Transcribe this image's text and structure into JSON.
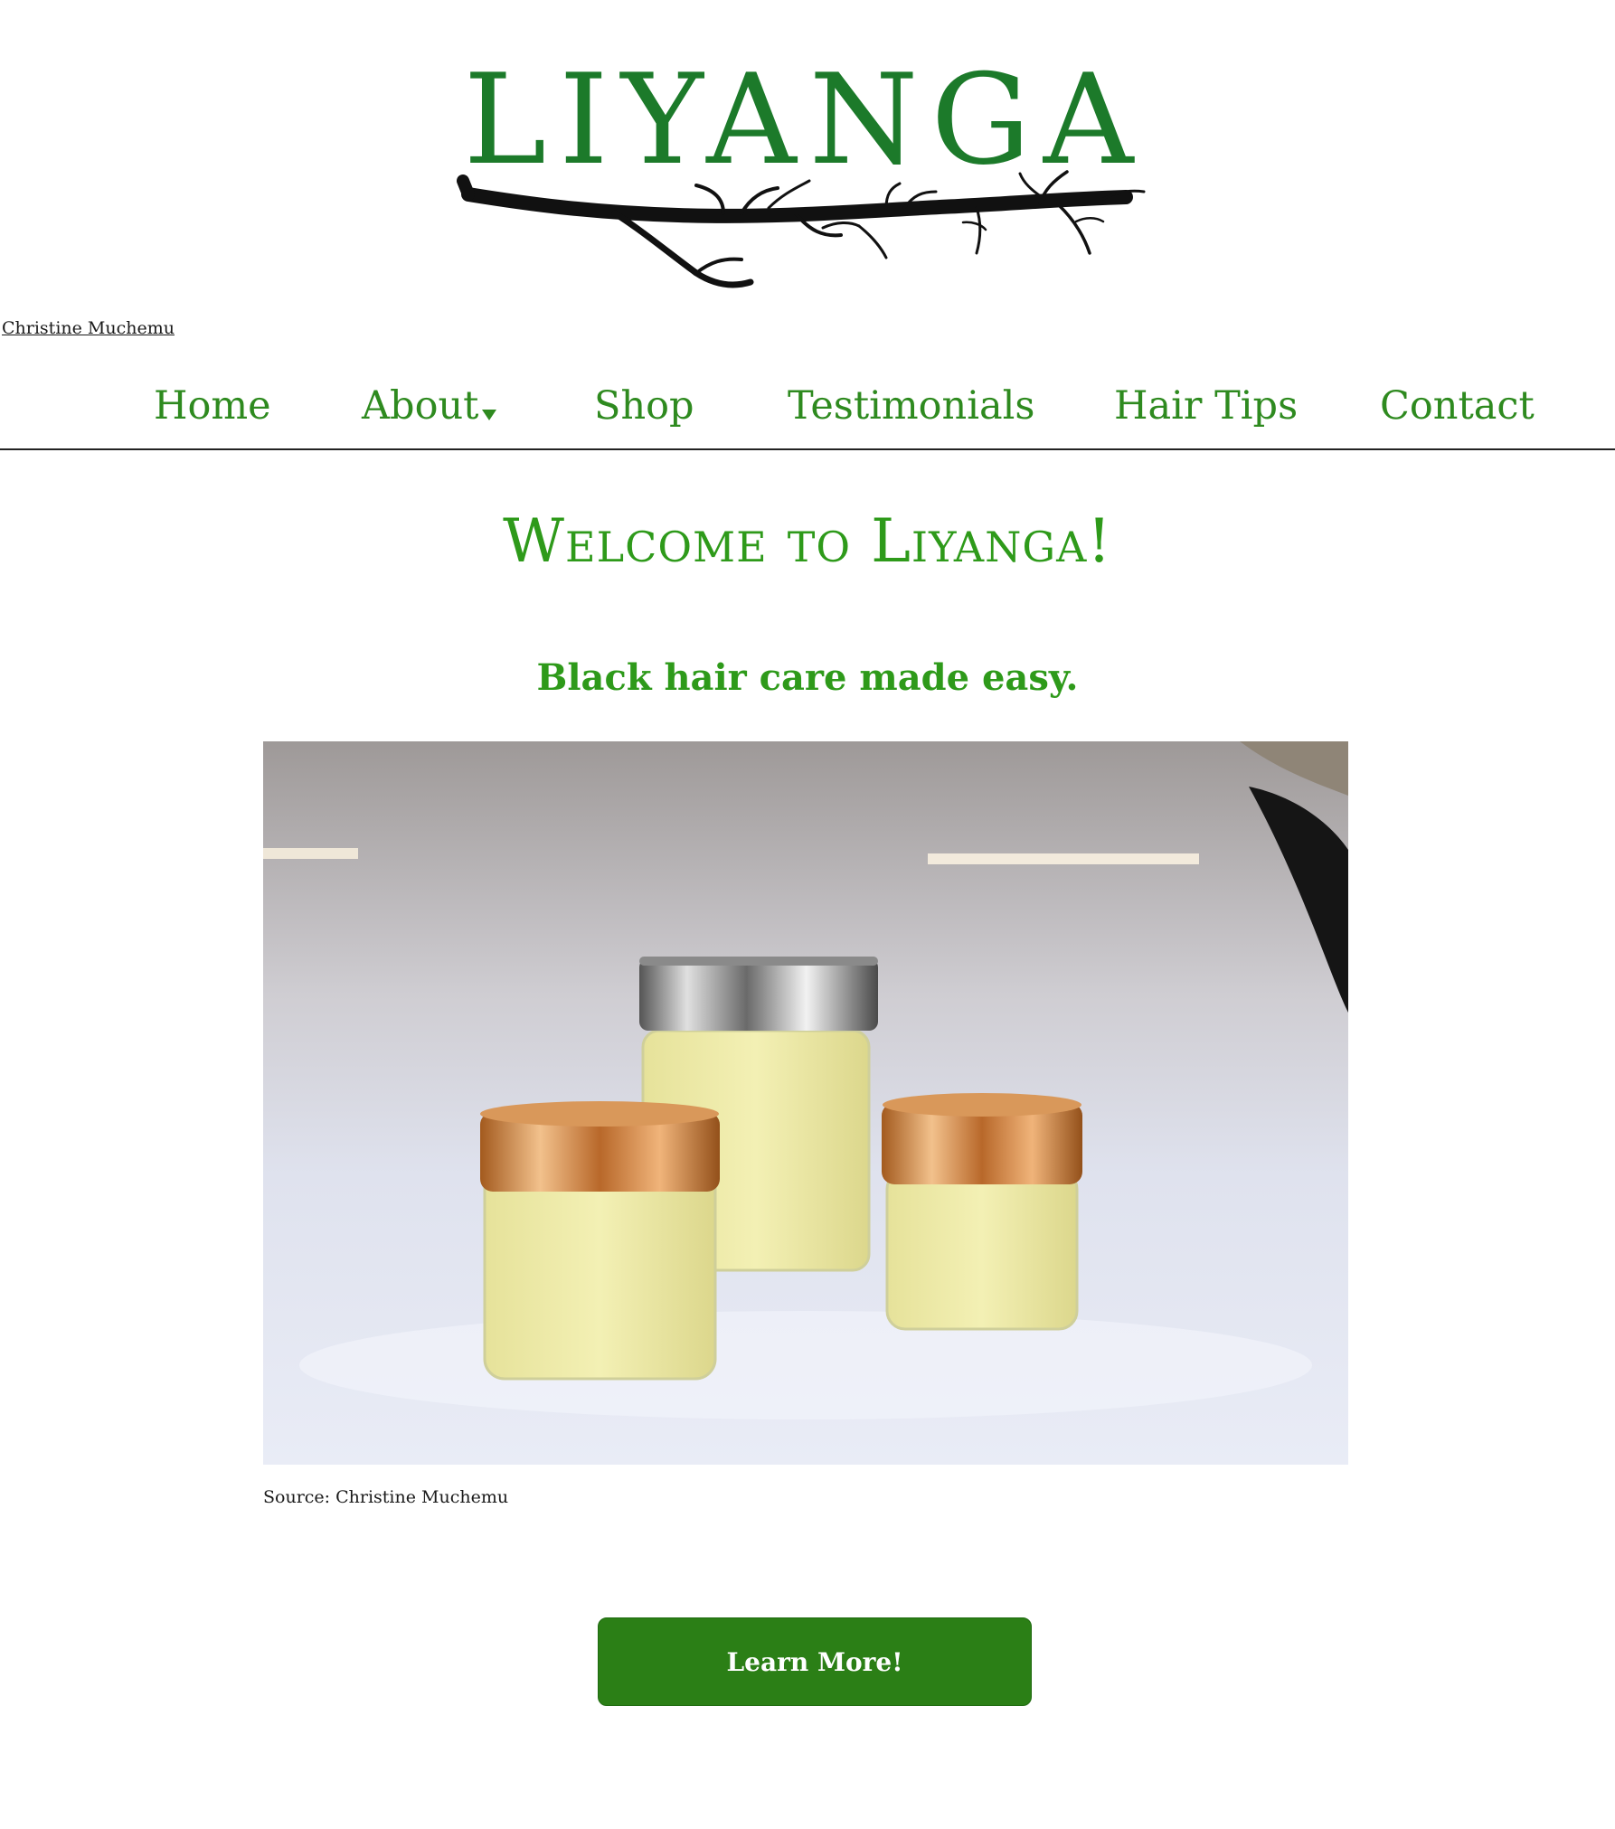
{
  "brand": {
    "logo_text": "LIYANGA",
    "logo_color": "#1c7a2a"
  },
  "credit": {
    "link_text": "Christine Muchemu"
  },
  "nav": {
    "items": [
      {
        "label": "Home"
      },
      {
        "label": "About",
        "has_dropdown": true
      },
      {
        "label": "Shop"
      },
      {
        "label": "Testimonials"
      },
      {
        "label": "Hair Tips"
      },
      {
        "label": "Contact"
      }
    ],
    "color": "#2e8a1f"
  },
  "hero": {
    "welcome": "Welcome to Liyanga!",
    "tagline": "Black hair care made easy.",
    "heading_color": "#2e9a1a"
  },
  "photo": {
    "source_caption": "Source: Christine Muchemu"
  },
  "cta": {
    "label": "Learn More!",
    "color": "#2b7f16"
  }
}
